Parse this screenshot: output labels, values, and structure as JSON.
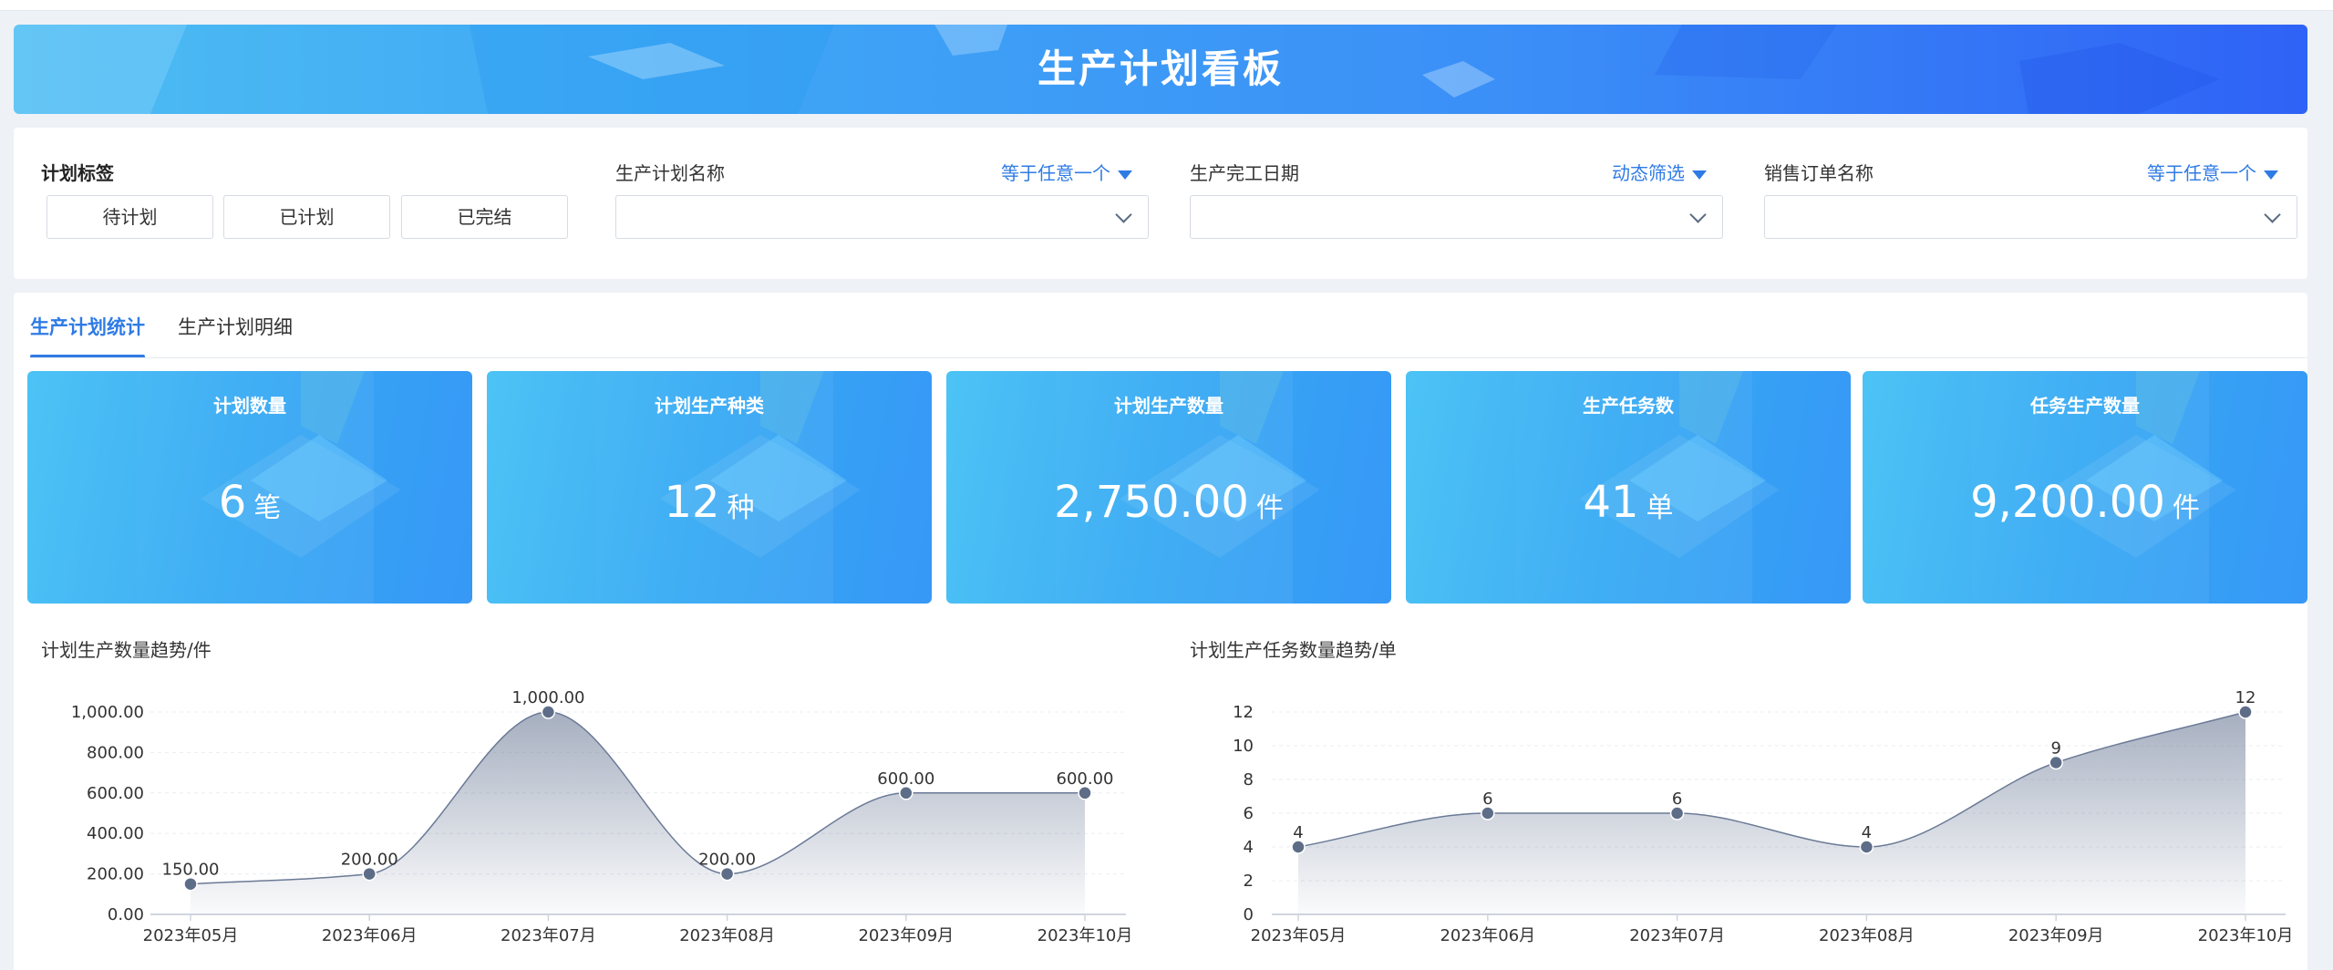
{
  "banner": {
    "title": "生产计划看板"
  },
  "filters": {
    "plan_tag": {
      "label": "计划标签",
      "options": [
        "待计划",
        "已计划",
        "已完结"
      ]
    },
    "plan_name": {
      "label": "生产计划名称",
      "operator": "等于任意一个"
    },
    "finish_date": {
      "label": "生产完工日期",
      "operator": "动态筛选"
    },
    "sales_order": {
      "label": "销售订单名称",
      "operator": "等于任意一个"
    }
  },
  "tabs": [
    {
      "label": "生产计划统计",
      "active": true
    },
    {
      "label": "生产计划明细",
      "active": false
    }
  ],
  "kpis": [
    {
      "title": "计划数量",
      "value": "6",
      "unit": "笔"
    },
    {
      "title": "计划生产种类",
      "value": "12",
      "unit": "种"
    },
    {
      "title": "计划生产数量",
      "value": "2,750.00",
      "unit": "件"
    },
    {
      "title": "生产任务数",
      "value": "41",
      "unit": "单"
    },
    {
      "title": "任务生产数量",
      "value": "9,200.00",
      "unit": "件"
    }
  ],
  "chart_data": [
    {
      "type": "area",
      "title": "计划生产数量趋势/件",
      "categories": [
        "2023年05月",
        "2023年06月",
        "2023年07月",
        "2023年08月",
        "2023年09月",
        "2023年10月"
      ],
      "values": [
        150,
        200,
        1000,
        200,
        600,
        600
      ],
      "value_labels": [
        "150.00",
        "200.00",
        "1,000.00",
        "200.00",
        "600.00",
        "600.00"
      ],
      "ylim": [
        0,
        1000
      ],
      "yticks": [
        0,
        200,
        400,
        600,
        800,
        1000
      ],
      "ytick_labels": [
        "0.00",
        "200.00",
        "400.00",
        "600.00",
        "800.00",
        "1,000.00"
      ],
      "grid": true,
      "smooth": true,
      "color": "#6b7a96"
    },
    {
      "type": "area",
      "title": "计划生产任务数量趋势/单",
      "categories": [
        "2023年05月",
        "2023年06月",
        "2023年07月",
        "2023年08月",
        "2023年09月",
        "2023年10月"
      ],
      "values": [
        4,
        6,
        6,
        4,
        9,
        12
      ],
      "value_labels": [
        "4",
        "6",
        "6",
        "4",
        "9",
        "12"
      ],
      "ylim": [
        0,
        12
      ],
      "yticks": [
        0,
        2,
        4,
        6,
        8,
        10,
        12
      ],
      "ytick_labels": [
        "0",
        "2",
        "4",
        "6",
        "8",
        "10",
        "12"
      ],
      "grid": true,
      "smooth": true,
      "color": "#6b7a96"
    }
  ]
}
